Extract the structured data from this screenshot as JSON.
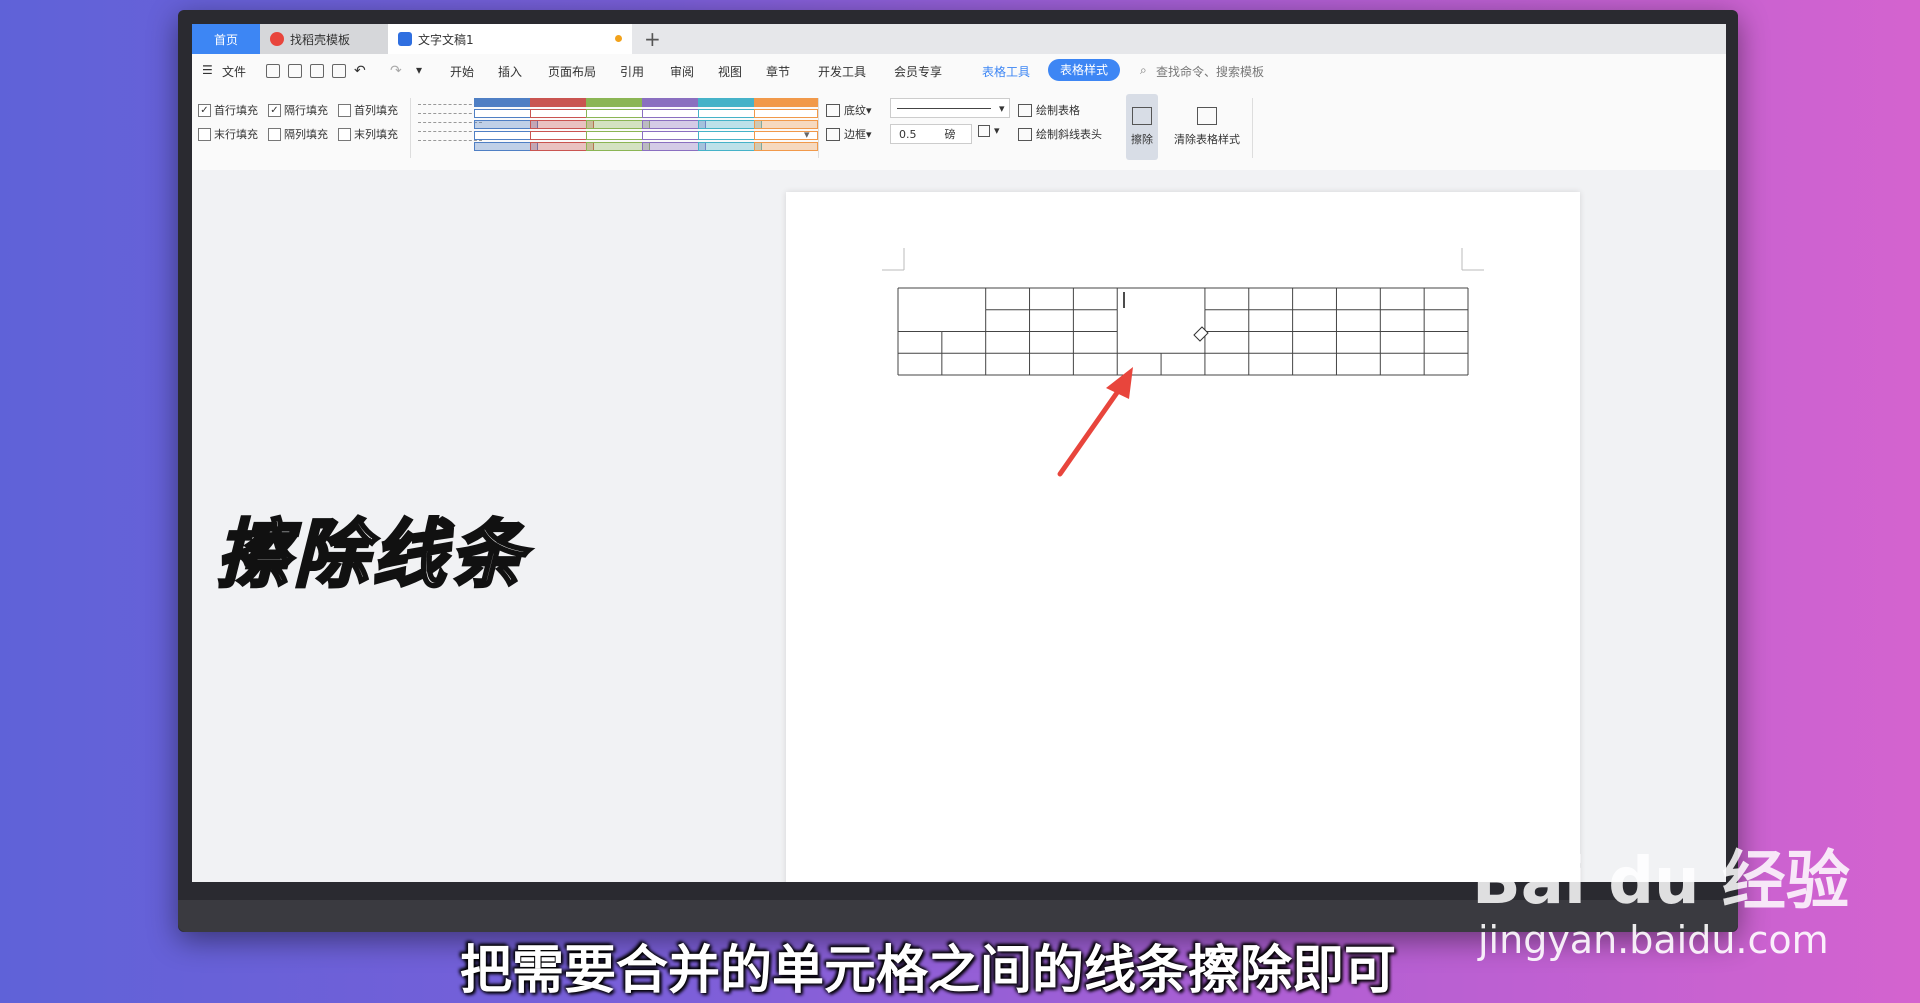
{
  "tabs": {
    "home": "首页",
    "find": "找稻壳模板",
    "doc": "文字文稿1",
    "add": "+"
  },
  "menu": {
    "file": "文件",
    "items": [
      "开始",
      "插入",
      "页面布局",
      "引用",
      "审阅",
      "视图",
      "章节",
      "开发工具",
      "会员专享"
    ],
    "table_tools": "表格工具",
    "table_style": "表格样式",
    "search": "查找命令、搜索模板"
  },
  "ribbon": {
    "checks": [
      {
        "label": "首行填充",
        "checked": true
      },
      {
        "label": "隔行填充",
        "checked": true
      },
      {
        "label": "首列填充",
        "checked": false
      },
      {
        "label": "末行填充",
        "checked": false
      },
      {
        "label": "隔列填充",
        "checked": false
      },
      {
        "label": "末列填充",
        "checked": false
      }
    ],
    "swatch_colors": [
      "#9a9a9a",
      "#4f7fc4",
      "#c95450",
      "#8bb554",
      "#8a6fc0",
      "#45b2c8",
      "#f1994a"
    ],
    "shading": "底纹",
    "border": "边框",
    "line_width": "0.5",
    "unit": "磅",
    "draw_table": "绘制表格",
    "draw_diag": "绘制斜线表头",
    "erase": "擦除",
    "clear_style": "清除表格样式"
  },
  "overlay": {
    "title": "擦除线条",
    "subtitle": "把需要合并的单元格之间的线条擦除即可"
  },
  "watermark": {
    "brand": "Bai du 经验",
    "url": "jingyan.baidu.com"
  },
  "colors": {
    "accent": "#3d86f4",
    "arrow": "#e8453c"
  }
}
